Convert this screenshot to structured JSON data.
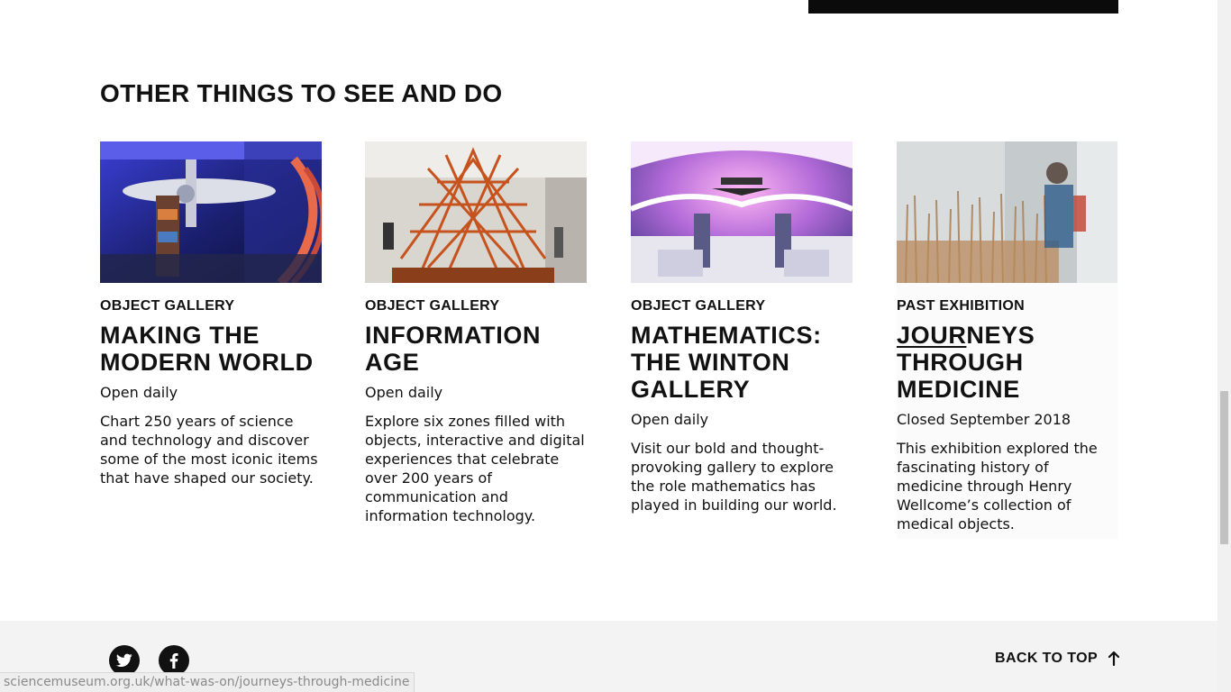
{
  "section": {
    "title": "OTHER THINGS TO SEE AND DO"
  },
  "cards": [
    {
      "category": "OBJECT GALLERY",
      "title_lines": [
        "MAKING THE",
        "MODERN WORLD"
      ],
      "status": "Open daily",
      "description": "Chart 250 years of science and technology and discover some of the most iconic items that have shaped our society."
    },
    {
      "category": "OBJECT GALLERY",
      "title_lines": [
        "INFORMATION AGE"
      ],
      "status": "Open daily",
      "description": "Explore six zones filled with objects, interactive and digital experiences that celebrate over 200 years of communication and information technology."
    },
    {
      "category": "OBJECT GALLERY",
      "title_lines": [
        "MATHEMATICS:",
        "THE WINTON",
        "GALLERY"
      ],
      "status": "Open daily",
      "description": "Visit our bold and thought-provoking gallery to explore the role mathematics has played in building our world."
    },
    {
      "category": "PAST EXHIBITION",
      "title_part_underlined": "JOUR",
      "title_part_rest": "NEYS",
      "title_lines": [
        "THROUGH",
        "MEDICINE"
      ],
      "status": "Closed September 2018",
      "description": "This exhibition explored the fascinating history of medicine through Henry Wellcome’s collection of medical objects."
    }
  ],
  "footer": {
    "back_to_top": "BACK TO TOP",
    "social_icons": [
      "twitter-icon",
      "facebook-icon"
    ]
  },
  "status_bar": {
    "url": "sciencemuseum.org.uk/what-was-on/journeys-through-medicine"
  },
  "colors": {
    "text": "#111111",
    "footer_bg": "#f3f3f3"
  }
}
